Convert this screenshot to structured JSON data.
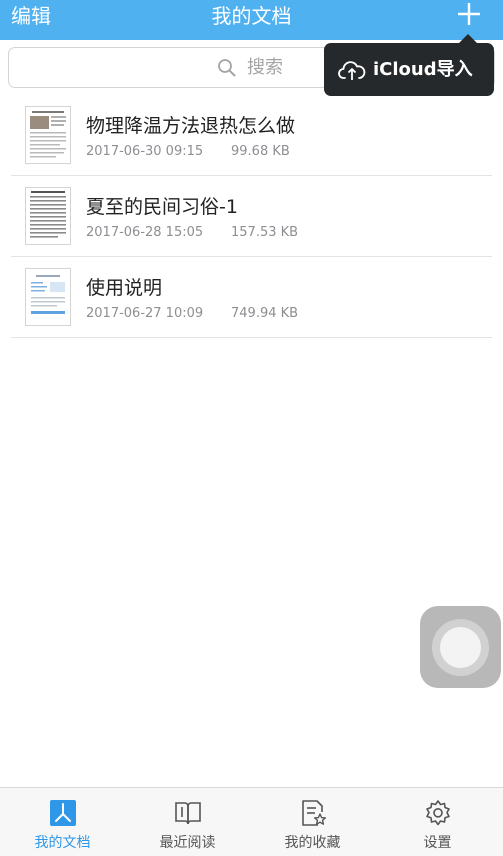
{
  "colors": {
    "nav_bg": "#4fb1f0",
    "accent": "#2f97e8",
    "popover_bg": "#26292c"
  },
  "nav": {
    "edit_label": "编辑",
    "title": "我的文档",
    "add_icon": "plus-icon"
  },
  "search": {
    "placeholder": "搜索",
    "icon": "search-icon"
  },
  "popover": {
    "icon": "cloud-upload-icon",
    "label": "iCloud导入"
  },
  "documents": [
    {
      "title": "物理降温方法退热怎么做",
      "date": "2017-06-30 09:15",
      "size": "99.68 KB"
    },
    {
      "title": "夏至的民间习俗-1",
      "date": "2017-06-28 15:05",
      "size": "157.53 KB"
    },
    {
      "title": "使用说明",
      "date": "2017-06-27 10:09",
      "size": "749.94 KB"
    }
  ],
  "tabs": [
    {
      "label": "我的文档",
      "icon": "pdf-document-icon",
      "active": true
    },
    {
      "label": "最近阅读",
      "icon": "open-book-icon",
      "active": false
    },
    {
      "label": "我的收藏",
      "icon": "favorite-document-icon",
      "active": false
    },
    {
      "label": "设置",
      "icon": "gear-icon",
      "active": false
    }
  ]
}
